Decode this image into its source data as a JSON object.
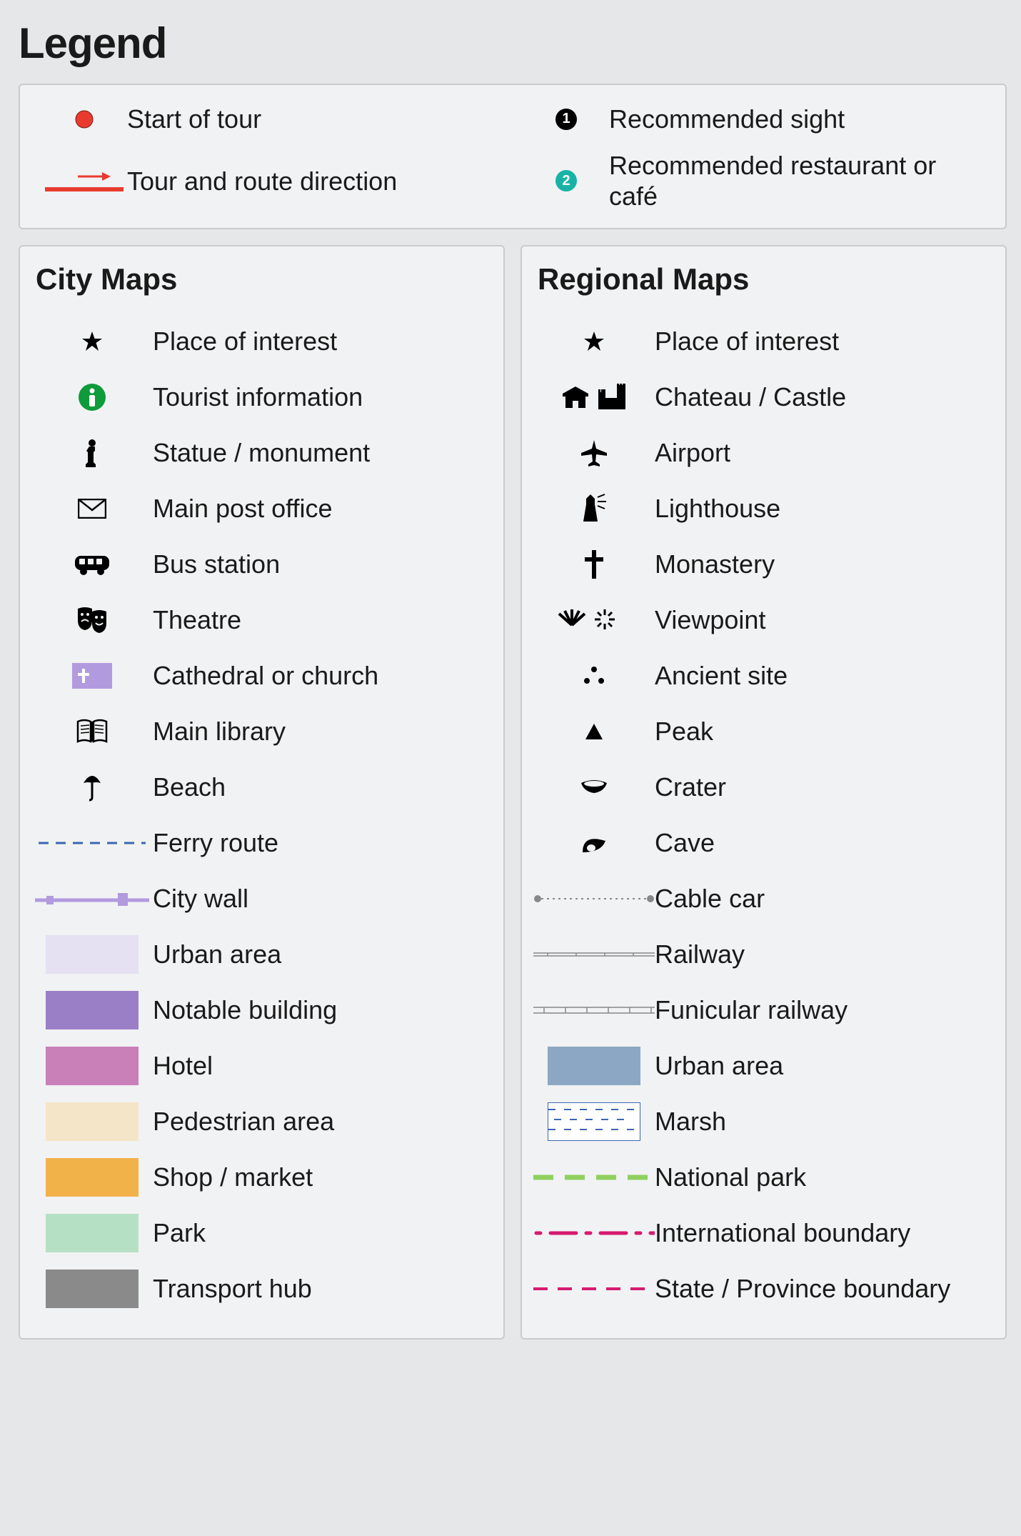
{
  "title": "Legend",
  "top": {
    "r0c0": "Start of tour",
    "r0c1": "Recommended sight",
    "r1c0": "Tour and route direction",
    "r1c1": "Recommended restaurant or café",
    "badge_sight": "1",
    "badge_food": "2"
  },
  "city": {
    "heading": "City Maps",
    "items": [
      "Place of interest",
      "Tourist information",
      "Statue / monument",
      "Main post office",
      "Bus station",
      "Theatre",
      "Cathedral or church",
      "Main library",
      "Beach",
      "Ferry route",
      "City wall",
      "Urban area",
      "Notable building",
      "Hotel",
      "Pedestrian area",
      "Shop / market",
      "Park",
      "Transport hub"
    ]
  },
  "regional": {
    "heading": "Regional Maps",
    "items": [
      "Place of interest",
      "Chateau / Castle",
      "Airport",
      "Lighthouse",
      "Monastery",
      "Viewpoint",
      "Ancient site",
      "Peak",
      "Crater",
      "Cave",
      "Cable car",
      "Railway",
      "Funicular railway",
      "Urban area",
      "Marsh",
      "National park",
      "International boundary",
      "State / Province boundary"
    ]
  }
}
